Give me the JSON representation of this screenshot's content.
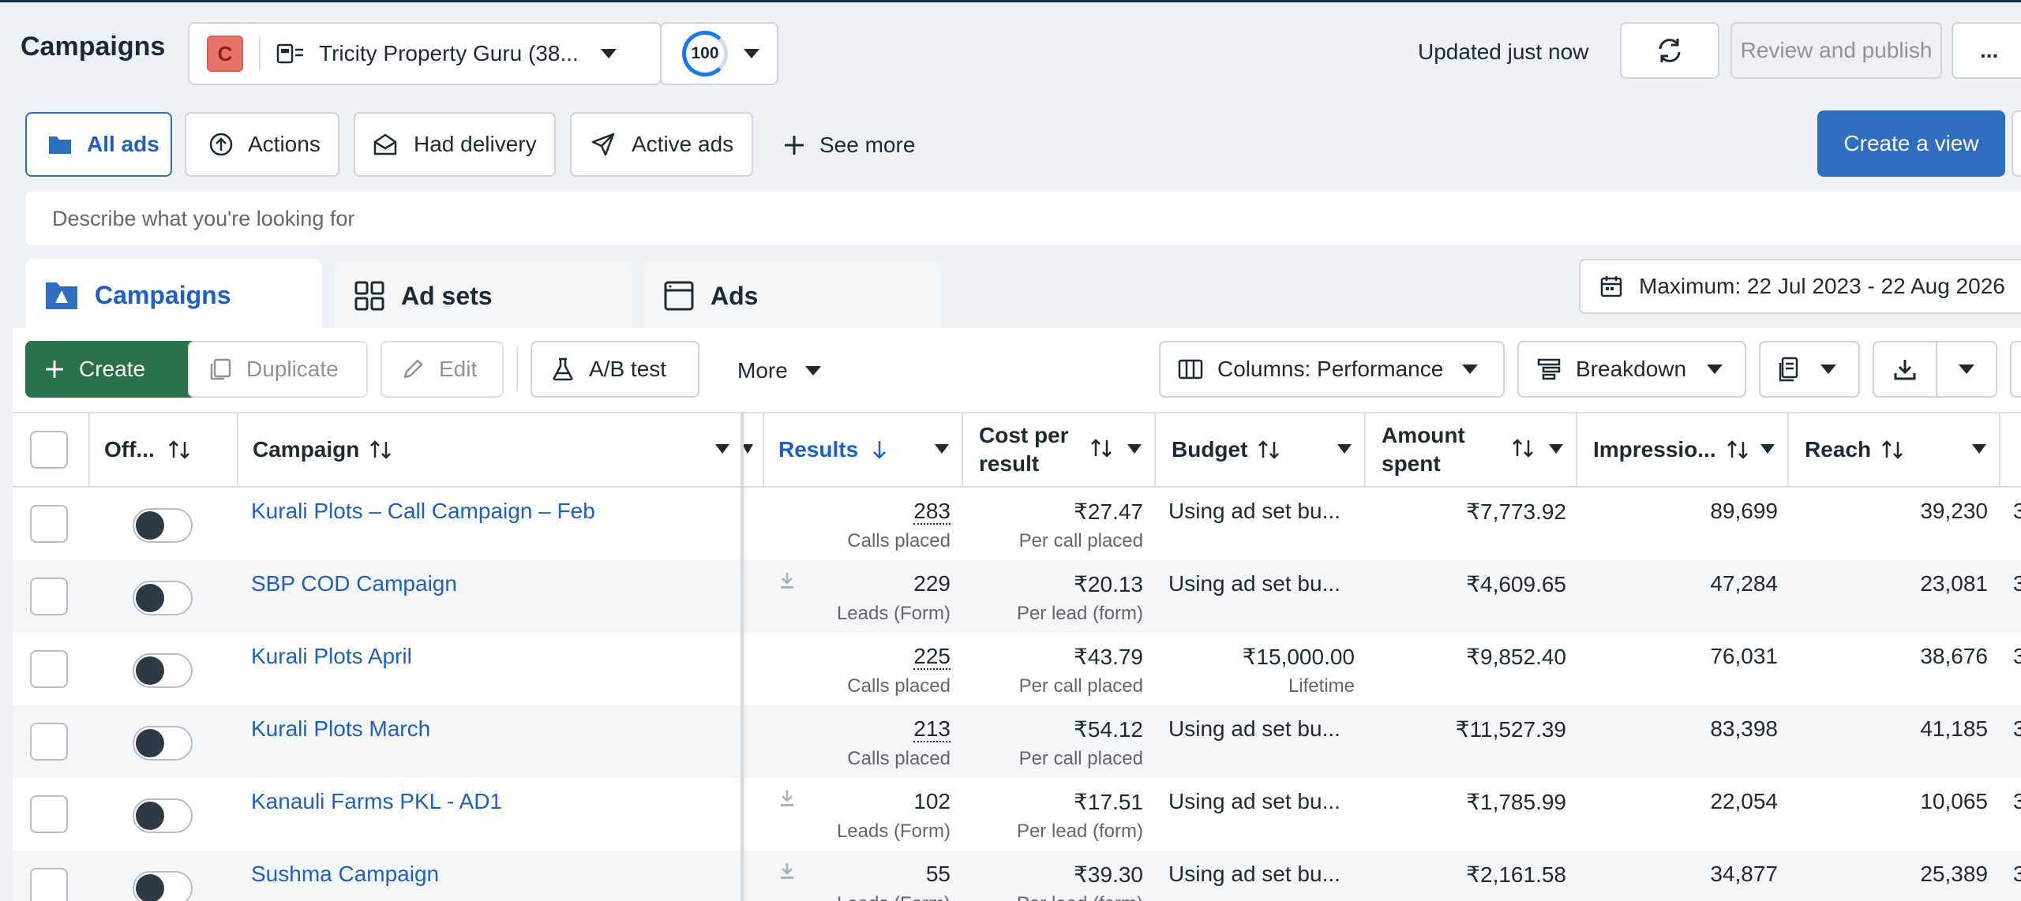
{
  "header": {
    "title": "Campaigns",
    "account_initial": "C",
    "account_name": "Tricity Property Guru (38...",
    "score": "100",
    "updated": "Updated just now",
    "review_label": "Review and publish",
    "more_label": "..."
  },
  "views": {
    "items": [
      "All ads",
      "Actions",
      "Had delivery",
      "Active ads"
    ],
    "see_more": "See more",
    "create_view": "Create a view"
  },
  "search": {
    "placeholder": "Describe what you're looking for"
  },
  "tabs": [
    "Campaigns",
    "Ad sets",
    "Ads"
  ],
  "date_range": "Maximum: 22 Jul 2023 - 22 Aug 2026",
  "toolbar": {
    "create": "Create",
    "duplicate": "Duplicate",
    "edit": "Edit",
    "ab_test": "A/B test",
    "more": "More",
    "columns": "Columns: Performance",
    "breakdown": "Breakdown"
  },
  "table": {
    "headers": {
      "off": "Off...",
      "campaign": "Campaign",
      "results": "Results",
      "cpr_1": "Cost per",
      "cpr_2": "result",
      "budget": "Budget",
      "amount_1": "Amount",
      "amount_2": "spent",
      "impressions": "Impressio...",
      "reach": "Reach"
    },
    "rows": [
      {
        "name": "Kurali Plots – Call Campaign – Feb",
        "results": "283",
        "results_sub": "Calls placed",
        "cpr": "₹27.47",
        "cpr_sub": "Per call placed",
        "budget": "Using ad set bu...",
        "budget_sub": "",
        "spent": "₹7,773.92",
        "impressions": "89,699",
        "reach": "39,230"
      },
      {
        "name": "SBP COD Campaign",
        "results": "229",
        "results_sub": "Leads (Form)",
        "cpr": "₹20.13",
        "cpr_sub": "Per lead (form)",
        "budget": "Using ad set bu...",
        "budget_sub": "",
        "spent": "₹4,609.65",
        "impressions": "47,284",
        "reach": "23,081"
      },
      {
        "name": "Kurali Plots April",
        "results": "225",
        "results_sub": "Calls placed",
        "cpr": "₹43.79",
        "cpr_sub": "Per call placed",
        "budget": "₹15,000.00",
        "budget_sub": "Lifetime",
        "spent": "₹9,852.40",
        "impressions": "76,031",
        "reach": "38,676"
      },
      {
        "name": "Kurali Plots March",
        "results": "213",
        "results_sub": "Calls placed",
        "cpr": "₹54.12",
        "cpr_sub": "Per call placed",
        "budget": "Using ad set bu...",
        "budget_sub": "",
        "spent": "₹11,527.39",
        "impressions": "83,398",
        "reach": "41,185"
      },
      {
        "name": "Kanauli Farms PKL - AD1",
        "results": "102",
        "results_sub": "Leads (Form)",
        "cpr": "₹17.51",
        "cpr_sub": "Per lead (form)",
        "budget": "Using ad set bu...",
        "budget_sub": "",
        "spent": "₹1,785.99",
        "impressions": "22,054",
        "reach": "10,065"
      },
      {
        "name": "Sushma Campaign",
        "results": "55",
        "results_sub": "Leads (Form)",
        "cpr": "₹39.30",
        "cpr_sub": "Per lead (form)",
        "budget": "Using ad set bu...",
        "budget_sub": "",
        "spent": "₹2,161.58",
        "impressions": "34,877",
        "reach": "25,389"
      }
    ]
  },
  "colors": {
    "primary": "#2d6ec0",
    "create_green": "#2a7048",
    "link": "#1d5fc5"
  }
}
